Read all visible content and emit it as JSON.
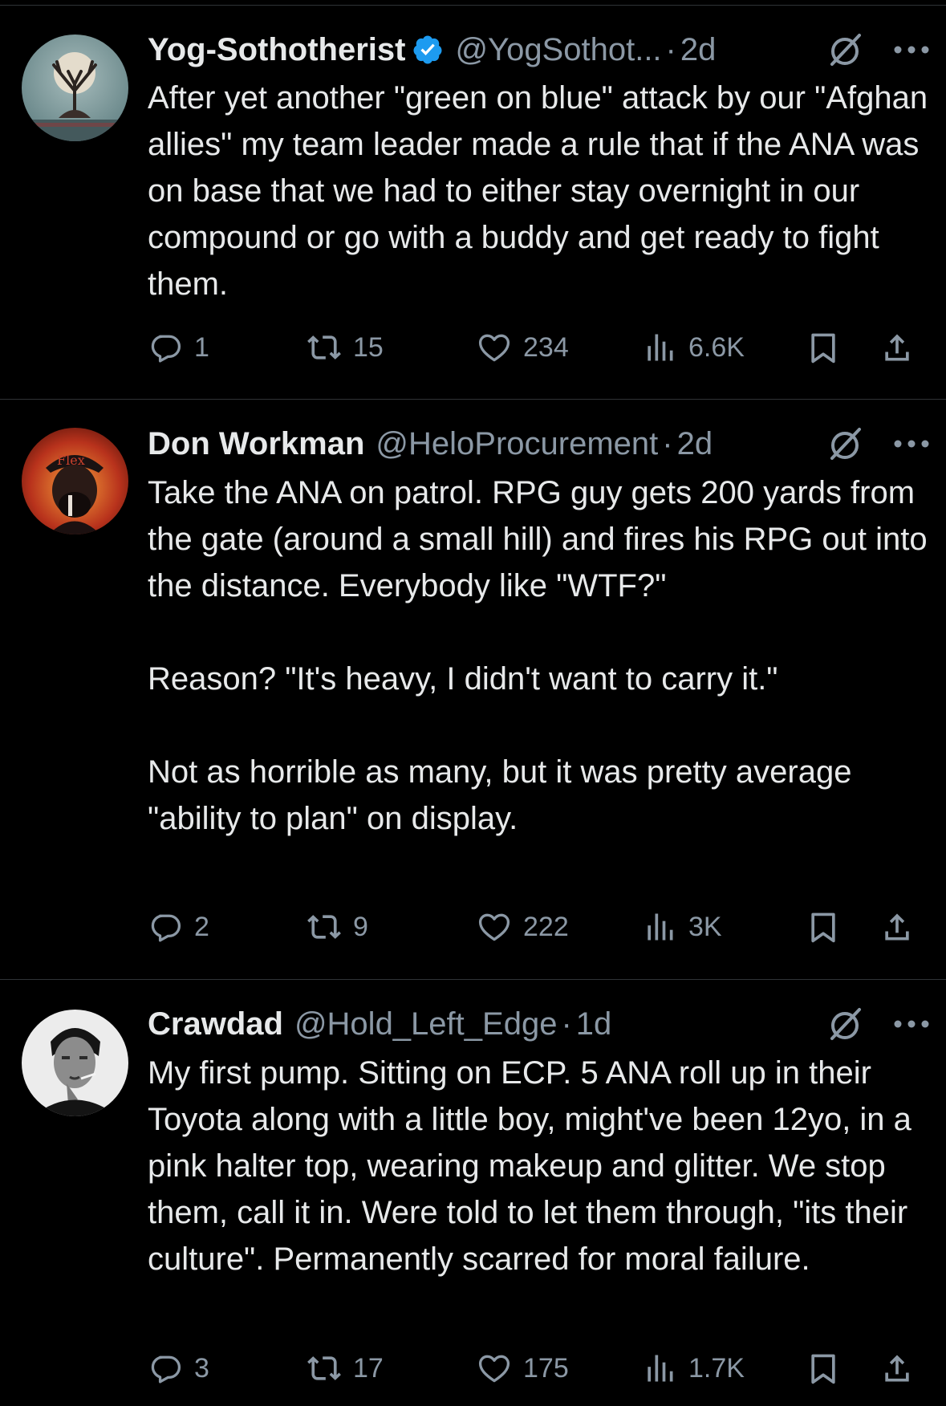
{
  "tweets": [
    {
      "name": "Yog-Sothotherist",
      "verified": true,
      "handle": "@YogSothot...",
      "separator": "·",
      "time": "2d",
      "paragraphs": [
        "After yet another \"green on blue\" attack by our \"Afghan allies\" my team leader made a rule that if the ANA was on base that we had to either stay overnight in our compound or go with a buddy and get ready to fight them."
      ],
      "replies": "1",
      "reposts": "15",
      "likes": "234",
      "views": "6.6K"
    },
    {
      "name": "Don Workman",
      "verified": false,
      "handle": "@HeloProcurement",
      "separator": "·",
      "time": "2d",
      "paragraphs": [
        "Take the ANA on patrol. RPG guy gets 200 yards from the gate (around a small hill) and fires his RPG out into the distance. Everybody like \"WTF?\"",
        "Reason? \"It's heavy, I didn't want to carry it.\"",
        "Not as horrible as many, but it was pretty average \"ability to plan\" on display."
      ],
      "replies": "2",
      "reposts": "9",
      "likes": "222",
      "views": "3K"
    },
    {
      "name": "Crawdad",
      "verified": false,
      "handle": "@Hold_Left_Edge",
      "separator": "·",
      "time": "1d",
      "paragraphs": [
        "My first pump. Sitting on ECP. 5 ANA roll up in their Toyota along with a little boy, might've been 12yo, in a pink halter top, wearing makeup and glitter. We stop them, call it in. Were told to let them through, \"its their culture\". Permanently scarred for moral failure."
      ],
      "replies": "3",
      "reposts": "17",
      "likes": "175",
      "views": "1.7K"
    }
  ],
  "colors": {
    "background": "#000000",
    "text": "#e7e9ea",
    "secondary": "#8b98a5",
    "divider": "#2f3336",
    "verified": "#1d9bf0"
  },
  "icons": [
    "verified-badge-icon",
    "grok-icon",
    "more-icon",
    "reply-icon",
    "repost-icon",
    "like-icon",
    "views-icon",
    "bookmark-icon",
    "share-icon"
  ]
}
